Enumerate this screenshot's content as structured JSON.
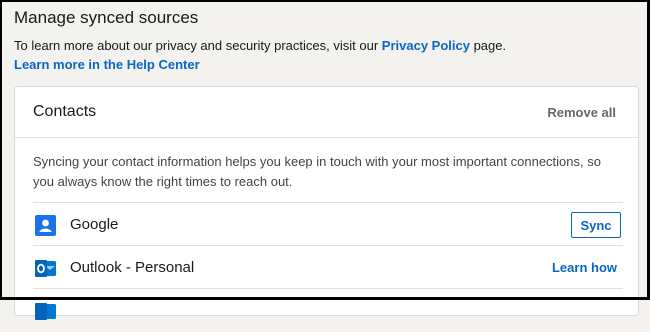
{
  "page": {
    "title": "Manage synced sources",
    "intro_text": "To learn more about our privacy and security practices, visit our ",
    "privacy_link": "Privacy Policy",
    "intro_suffix": " page.",
    "help_link": "Learn more in the Help Center"
  },
  "card": {
    "title": "Contacts",
    "remove_all": "Remove all",
    "description": "Syncing your contact information helps you keep in touch with your most important connections, so you always know the right times to reach out.",
    "sources": [
      {
        "name": "Google",
        "action": "Sync",
        "icon": "google-contacts-icon"
      },
      {
        "name": "Outlook - Personal",
        "action": "Learn how",
        "icon": "outlook-icon"
      },
      {
        "name": "",
        "action": "",
        "icon": "outlook-icon"
      }
    ]
  },
  "colors": {
    "accent": "#0a66c2",
    "background": "#f3f2ef",
    "card": "#ffffff"
  }
}
